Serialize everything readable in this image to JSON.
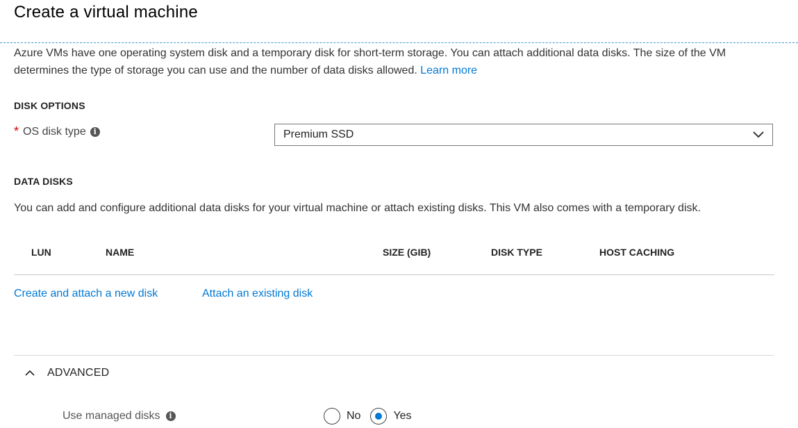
{
  "page": {
    "title": "Create a virtual machine"
  },
  "intro": {
    "text": "Azure VMs have one operating system disk and a temporary disk for short-term storage. You can attach additional data disks. The size of the VM determines the type of storage you can use and the number of data disks allowed. ",
    "learn_more": "Learn more"
  },
  "disk_options": {
    "heading": "DISK OPTIONS",
    "os_disk_type": {
      "required_mark": "*",
      "label": "OS disk type",
      "value": "Premium SSD",
      "info_icon": "i"
    }
  },
  "data_disks": {
    "heading": "DATA DISKS",
    "description": "You can add and configure additional data disks for your virtual machine or attach existing disks. This VM also comes with a temporary disk.",
    "columns": [
      "LUN",
      "NAME",
      "SIZE (GIB)",
      "DISK TYPE",
      "HOST CACHING"
    ],
    "create_link": "Create and attach a new disk",
    "attach_link": "Attach an existing disk"
  },
  "advanced": {
    "heading": "ADVANCED",
    "use_managed_disks": {
      "label": "Use managed disks",
      "info_icon": "i",
      "options": [
        "No",
        "Yes"
      ],
      "selected": "Yes"
    }
  },
  "colors": {
    "accent": "#0078d4",
    "required": "#dd0000"
  }
}
